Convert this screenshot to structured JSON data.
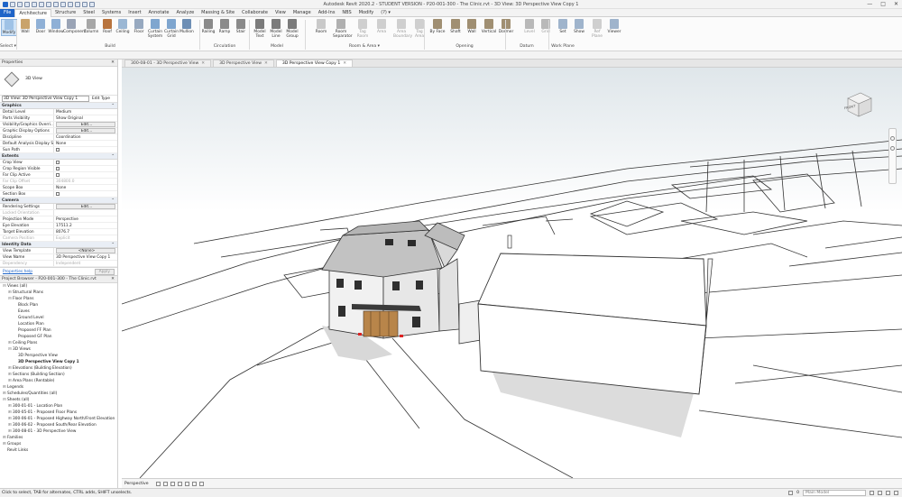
{
  "app": {
    "title": "Autodesk Revit 2020.2 - STUDENT VERSION - P20-001-300 - The Clinic.rvt - 3D View: 3D Perspective View Copy 1",
    "window_controls": [
      "—",
      "□",
      "✕"
    ]
  },
  "ribbon_tabs": [
    "File",
    "Architecture",
    "Structure",
    "Steel",
    "Systems",
    "Insert",
    "Annotate",
    "Analyze",
    "Massing & Site",
    "Collaborate",
    "View",
    "Manage",
    "Add-Ins",
    "NBS",
    "Modify",
    "(?) ▾"
  ],
  "ribbon": {
    "buttons": [
      "Modify",
      "Wall",
      "Door",
      "Window",
      "Component",
      "Column",
      "Roof",
      "Ceiling",
      "Floor",
      "Curtain System",
      "Curtain Grid",
      "Mullion",
      "Railing",
      "Ramp",
      "Stair",
      "Model Text",
      "Model Line",
      "Model Group",
      "Room",
      "Room Separator",
      "Tag Room",
      "Area",
      "Area Boundary",
      "Tag Area",
      "By Face",
      "Shaft",
      "Wall",
      "Vertical",
      "Dormer",
      "Level",
      "Grid",
      "Set",
      "Show",
      "Ref Plane",
      "Viewer"
    ],
    "groups": [
      "Select ▾",
      "Build",
      "Circulation",
      "Model",
      "Room & Area ▾",
      "Opening",
      "Datum",
      "Work Plane"
    ]
  },
  "view_tabs": [
    {
      "label": "300-08-01 - 3D Perspective View",
      "active": false
    },
    {
      "label": "3D Perspective View",
      "active": false
    },
    {
      "label": "3D Perspective View Copy 1",
      "active": true
    }
  ],
  "properties": {
    "header": "Properties",
    "type_name": "3D View",
    "selector": "3D View: 3D Perspective View Copy 1",
    "edit_type": "Edit Type",
    "groups": [
      {
        "name": "Graphics",
        "rows": [
          {
            "k": "Detail Level",
            "v": "Medium"
          },
          {
            "k": "Parts Visibility",
            "v": "Show Original"
          },
          {
            "k": "Visibility/Graphics Overri...",
            "v": "Edit...",
            "btn": true
          },
          {
            "k": "Graphic Display Options",
            "v": "Edit...",
            "btn": true
          },
          {
            "k": "Discipline",
            "v": "Coordination"
          },
          {
            "k": "Default Analysis Display S...",
            "v": "None"
          },
          {
            "k": "Sun Path",
            "v": "",
            "cb": true
          }
        ]
      },
      {
        "name": "Extents",
        "rows": [
          {
            "k": "Crop View",
            "v": "",
            "cb": true
          },
          {
            "k": "Crop Region Visible",
            "v": "",
            "cb": true
          },
          {
            "k": "Far Clip Active",
            "v": "",
            "cb": true
          },
          {
            "k": "Far Clip Offset",
            "v": "304800.0",
            "dim": true
          },
          {
            "k": "Scope Box",
            "v": "None"
          },
          {
            "k": "Section Box",
            "v": "",
            "cb": true
          }
        ]
      },
      {
        "name": "Camera",
        "rows": [
          {
            "k": "Rendering Settings",
            "v": "Edit...",
            "btn": true
          },
          {
            "k": "Locked Orientation",
            "v": "",
            "dim": true
          },
          {
            "k": "Projection Mode",
            "v": "Perspective"
          },
          {
            "k": "Eye Elevation",
            "v": "17511.2"
          },
          {
            "k": "Target Elevation",
            "v": "8076.7"
          },
          {
            "k": "Camera Position",
            "v": "Explicit",
            "dim": true
          }
        ]
      },
      {
        "name": "Identity Data",
        "rows": [
          {
            "k": "View Template",
            "v": "<None>",
            "btn": true
          },
          {
            "k": "View Name",
            "v": "3D Perspective View Copy 1"
          },
          {
            "k": "Dependency",
            "v": "Independent",
            "dim": true
          }
        ]
      }
    ],
    "help_link": "Properties help",
    "apply": "Apply"
  },
  "project_browser": {
    "header": "Project Browser - P20-001-300 - The Clinic.rvt",
    "nodes": [
      {
        "t": "Views (all)",
        "d": 0,
        "tw": "⊟"
      },
      {
        "t": "Structural Plans",
        "d": 1,
        "tw": "⊞"
      },
      {
        "t": "Floor Plans",
        "d": 1,
        "tw": "⊟"
      },
      {
        "t": "Block Plan",
        "d": 2,
        "tw": ""
      },
      {
        "t": "Eaves",
        "d": 2,
        "tw": ""
      },
      {
        "t": "Ground Level",
        "d": 2,
        "tw": ""
      },
      {
        "t": "Location Plan",
        "d": 2,
        "tw": ""
      },
      {
        "t": "Proposed FF Plan",
        "d": 2,
        "tw": ""
      },
      {
        "t": "Proposed GF Plan",
        "d": 2,
        "tw": ""
      },
      {
        "t": "Ceiling Plans",
        "d": 1,
        "tw": "⊞"
      },
      {
        "t": "3D Views",
        "d": 1,
        "tw": "⊟"
      },
      {
        "t": "3D Perspective View",
        "d": 2,
        "tw": ""
      },
      {
        "t": "3D Perspective View Copy 1",
        "d": 2,
        "tw": "",
        "bold": true
      },
      {
        "t": "Elevations (Building Elevation)",
        "d": 1,
        "tw": "⊞"
      },
      {
        "t": "Sections (Building Section)",
        "d": 1,
        "tw": "⊞"
      },
      {
        "t": "Area Plans (Rentable)",
        "d": 1,
        "tw": "⊞"
      },
      {
        "t": "Legends",
        "d": 0,
        "tw": "⊞"
      },
      {
        "t": "Schedules/Quantities (all)",
        "d": 0,
        "tw": "⊞"
      },
      {
        "t": "Sheets (all)",
        "d": 0,
        "tw": "⊟"
      },
      {
        "t": "300-01-01 - Location Plan",
        "d": 1,
        "tw": "⊞"
      },
      {
        "t": "300-05-01 - Proposed Floor Plans",
        "d": 1,
        "tw": "⊞"
      },
      {
        "t": "300-06-01 - Proposed Highway North/Front Elevation",
        "d": 1,
        "tw": "⊞"
      },
      {
        "t": "300-06-02 - Proposed South/Rear Elevation",
        "d": 1,
        "tw": "⊞"
      },
      {
        "t": "300-08-01 - 3D Perspective View",
        "d": 1,
        "tw": "⊞"
      },
      {
        "t": "Families",
        "d": 0,
        "tw": "⊞"
      },
      {
        "t": "Groups",
        "d": 0,
        "tw": "⊞"
      },
      {
        "t": "Revit Links",
        "d": 0,
        "tw": ""
      }
    ]
  },
  "viewcube": {
    "face": "FRONT"
  },
  "view_control": {
    "mode": "Perspective"
  },
  "status": {
    "text": "Click to select, TAB for alternates, CTRL adds, SHIFT unselects.",
    "model": "Main Model",
    "counter": "0"
  },
  "colors": {
    "file_tab": "#1e64c8",
    "door": "#b8854a",
    "roof": "#bdbdbd",
    "wall": "#ededed"
  }
}
